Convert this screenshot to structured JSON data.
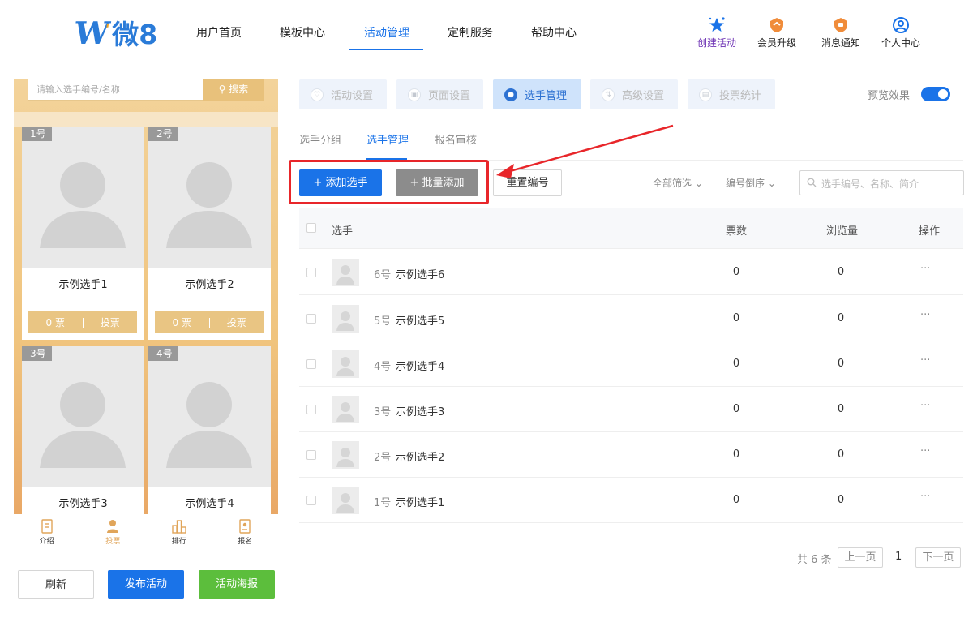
{
  "brand": {
    "logo_text": "微8"
  },
  "nav": {
    "items": [
      "用户首页",
      "模板中心",
      "活动管理",
      "定制服务",
      "帮助中心"
    ],
    "active_index": 2
  },
  "header_actions": {
    "create": "创建活动",
    "upgrade": "会员升级",
    "notify": "消息通知",
    "profile": "个人中心"
  },
  "phone": {
    "search_placeholder": "请输入选手编号/名称",
    "search_button": "搜索",
    "cards": [
      {
        "num": "1号",
        "name": "示例选手1",
        "votes": "0 票",
        "action": "投票"
      },
      {
        "num": "2号",
        "name": "示例选手2",
        "votes": "0 票",
        "action": "投票"
      },
      {
        "num": "3号",
        "name": "示例选手3"
      },
      {
        "num": "4号",
        "name": "示例选手4"
      }
    ],
    "tabs": [
      "介绍",
      "投票",
      "排行",
      "报名"
    ],
    "active_tab": 1
  },
  "bottom_buttons": {
    "refresh": "刷新",
    "publish": "发布活动",
    "poster": "活动海报"
  },
  "feature_tabs": [
    "活动设置",
    "页面设置",
    "选手管理",
    "高级设置",
    "投票统计"
  ],
  "feature_active": 2,
  "preview_toggle": {
    "label": "预览效果",
    "on": true
  },
  "subtabs": [
    "选手分组",
    "选手管理",
    "报名审核"
  ],
  "subtab_active": 1,
  "toolbar": {
    "add": "+ 添加选手",
    "batch": "+ 批量添加",
    "renumber": "重置编号",
    "filter": "全部筛选",
    "sort": "编号倒序",
    "search_placeholder": "选手编号、名称、简介"
  },
  "table": {
    "headers": {
      "contestant": "选手",
      "votes": "票数",
      "views": "浏览量",
      "ops": "操作"
    },
    "rows": [
      {
        "no": "6号",
        "name": "示例选手6",
        "votes": "0",
        "views": "0",
        "more": "···"
      },
      {
        "no": "5号",
        "name": "示例选手5",
        "votes": "0",
        "views": "0",
        "more": "···"
      },
      {
        "no": "4号",
        "name": "示例选手4",
        "votes": "0",
        "views": "0",
        "more": "···"
      },
      {
        "no": "3号",
        "name": "示例选手3",
        "votes": "0",
        "views": "0",
        "more": "···"
      },
      {
        "no": "2号",
        "name": "示例选手2",
        "votes": "0",
        "views": "0",
        "more": "···"
      },
      {
        "no": "1号",
        "name": "示例选手1",
        "votes": "0",
        "views": "0",
        "more": "···"
      }
    ]
  },
  "pagination": {
    "total": "共 6 条",
    "prev": "上一页",
    "current": "1",
    "next": "下一页"
  },
  "colors": {
    "primary": "#1a73e8",
    "highlight": "#e8262a",
    "gold": "#e9c583",
    "green": "#5cbe3c"
  }
}
